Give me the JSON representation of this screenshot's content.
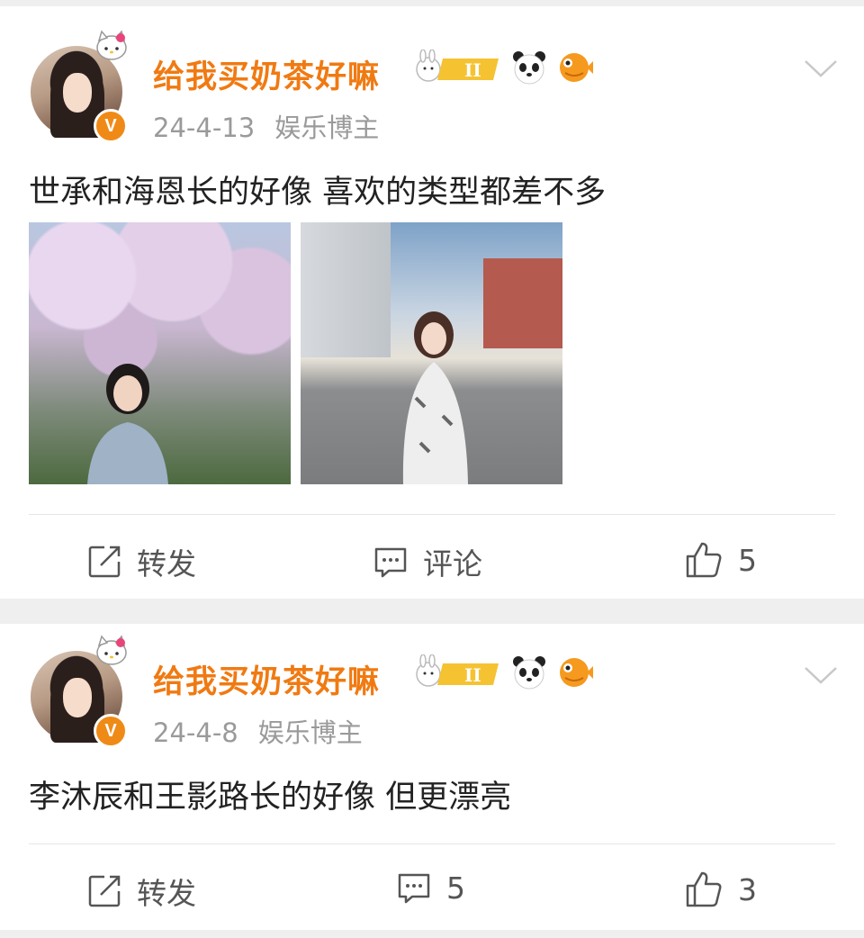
{
  "posts": [
    {
      "username": "给我买奶茶好嘛",
      "date": "24-4-13",
      "role": "娱乐博主",
      "verified_badge": "V",
      "text": "世承和海恩长的好像 喜欢的类型都差不多",
      "photos": [
        "cherry-blossom-photo",
        "street-photo"
      ],
      "actions": {
        "repost_label": "转发",
        "comment_label": "评论",
        "likes": "5"
      }
    },
    {
      "username": "给我买奶茶好嘛",
      "date": "24-4-8",
      "role": "娱乐博主",
      "verified_badge": "V",
      "text": "李沐辰和王影路长的好像 但更漂亮",
      "actions": {
        "repost_label": "转发",
        "comments": "5",
        "likes": "3"
      }
    }
  ],
  "badge_icons": [
    "gemini-rank-badge-icon",
    "panda-icon",
    "pufferfish-icon"
  ],
  "colors": {
    "username": "#f07a12",
    "meta": "#9a9a9a",
    "text": "#222222",
    "verified": "#f08a16"
  }
}
